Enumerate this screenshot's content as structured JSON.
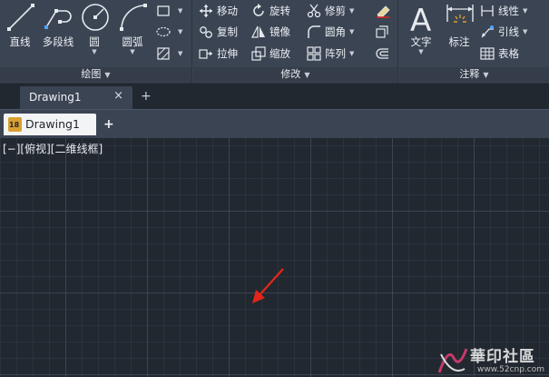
{
  "ribbon": {
    "draw_panel": {
      "title": "绘图",
      "line": "直线",
      "polyline": "多段线",
      "circle": "圆",
      "arc": "圆弧"
    },
    "modify_panel": {
      "title": "修改",
      "move": "移动",
      "rotate": "旋转",
      "trim": "修剪",
      "copy": "复制",
      "mirror": "镜像",
      "fillet": "圆角",
      "stretch": "拉伸",
      "scale": "缩放",
      "array": "阵列"
    },
    "annotation_panel": {
      "title": "注释",
      "text": "文字",
      "dimension": "标注",
      "linear": "线性",
      "leader": "引线",
      "table": "表格"
    }
  },
  "file_tabs": {
    "active": "Drawing1",
    "close_glyph": "×",
    "add_glyph": "+"
  },
  "doc_tabs": {
    "active": "Drawing1",
    "add_glyph": "+"
  },
  "viewport": {
    "label": "[−][俯视][二维线框]"
  },
  "watermark": {
    "text": "華印社區",
    "url": "www.52cnp.com"
  },
  "colors": {
    "ribbon_bg": "#3b4453",
    "canvas_bg": "#212830",
    "arrow_red": "#e0261c",
    "accent_gold": "#d9a032"
  }
}
